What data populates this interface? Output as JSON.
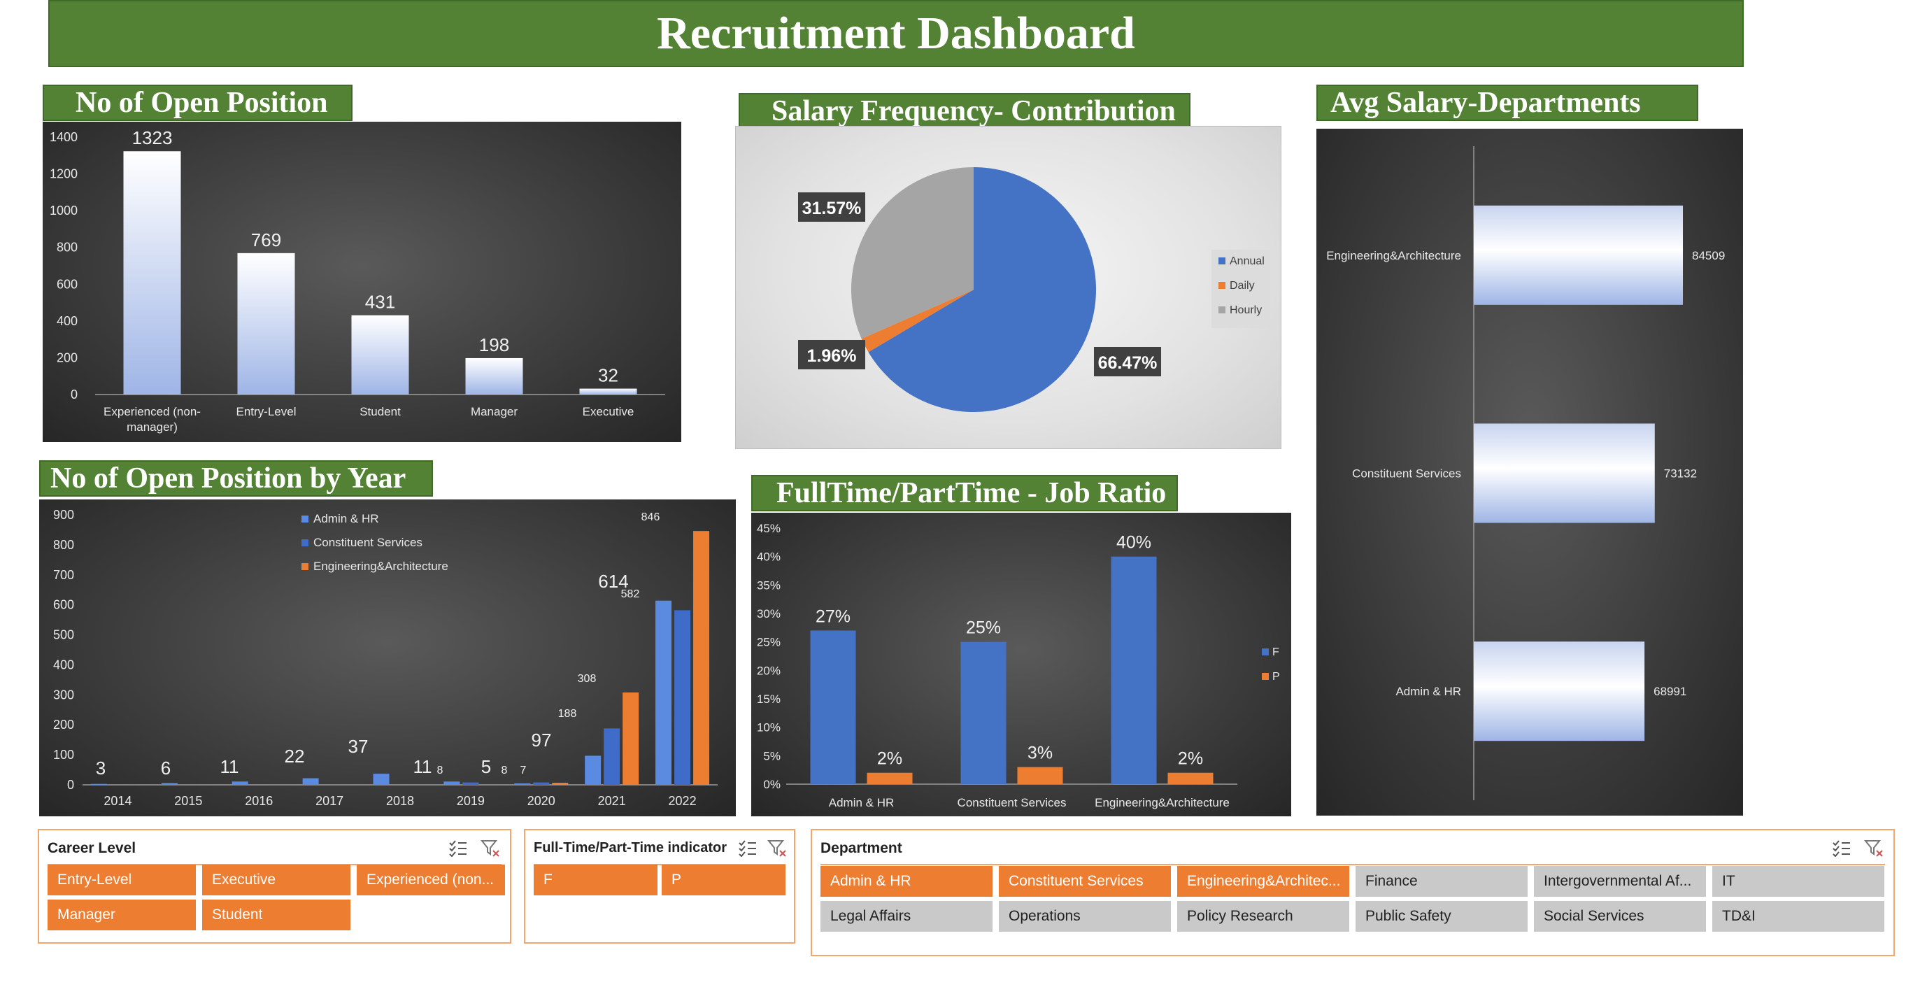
{
  "dashboard": {
    "title": "Recruitment Dashboard"
  },
  "sections": {
    "open_position": "No of Open Position",
    "salary_freq": "Salary Frequency- Contribution",
    "avg_salary": "Avg Salary-Departments",
    "by_year": "No of Open Position by Year",
    "job_ratio": "FullTime/PartTime - Job Ratio"
  },
  "colors": {
    "green": "#548235",
    "blue": "#4472c4",
    "orange": "#ed7d31",
    "gray": "#a5a5a5"
  },
  "chart_data": [
    {
      "id": "open_position",
      "type": "bar",
      "categories": [
        "Experienced (non-manager)",
        "Entry-Level",
        "Student",
        "Manager",
        "Executive"
      ],
      "values": [
        1323,
        769,
        431,
        198,
        32
      ],
      "ylim": [
        0,
        1400
      ],
      "yticks": [
        0,
        200,
        400,
        600,
        800,
        1000,
        1200,
        1400
      ],
      "grid": false
    },
    {
      "id": "salary_freq",
      "type": "pie",
      "labels": [
        "Annual",
        "Daily",
        "Hourly"
      ],
      "values": [
        66.47,
        1.96,
        31.57
      ],
      "data_labels": [
        "66.47%",
        "1.96%",
        "31.57%"
      ],
      "legend": "right"
    },
    {
      "id": "avg_salary",
      "type": "bar",
      "orientation": "horizontal",
      "categories": [
        "Engineering&Architecture",
        "Constituent Services",
        "Admin & HR"
      ],
      "values": [
        84509,
        73132,
        68991
      ]
    },
    {
      "id": "by_year",
      "type": "bar",
      "categories": [
        "2014",
        "2015",
        "2016",
        "2017",
        "2018",
        "2019",
        "2020",
        "2021",
        "2022"
      ],
      "series": [
        {
          "name": "Admin & HR",
          "values": [
            3,
            6,
            11,
            22,
            37,
            11,
            5,
            97,
            614
          ]
        },
        {
          "name": "Constituent Services",
          "values": [
            0,
            0,
            0,
            0,
            0,
            8,
            8,
            188,
            582
          ]
        },
        {
          "name": "Engineering&Architecture",
          "values": [
            0,
            0,
            0,
            0,
            0,
            0,
            7,
            308,
            846
          ]
        }
      ],
      "ylim": [
        0,
        900
      ],
      "yticks": [
        0,
        100,
        200,
        300,
        400,
        500,
        600,
        700,
        800,
        900
      ],
      "legend": "top-left"
    },
    {
      "id": "job_ratio",
      "type": "bar",
      "categories": [
        "Admin & HR",
        "Constituent Services",
        "Engineering&Architecture"
      ],
      "series": [
        {
          "name": "F",
          "values": [
            27,
            25,
            40
          ]
        },
        {
          "name": "P",
          "values": [
            2,
            3,
            2
          ]
        }
      ],
      "ylim": [
        0,
        45
      ],
      "yticks": [
        "0%",
        "5%",
        "10%",
        "15%",
        "20%",
        "25%",
        "30%",
        "35%",
        "40%",
        "45%"
      ],
      "legend": "right"
    }
  ],
  "slicers": {
    "career": {
      "title": "Career Level",
      "items": [
        {
          "label": "Entry-Level",
          "selected": true
        },
        {
          "label": "Executive",
          "selected": true
        },
        {
          "label": "Experienced (non...",
          "selected": true
        },
        {
          "label": "Manager",
          "selected": true
        },
        {
          "label": "Student",
          "selected": true
        }
      ]
    },
    "ftpt": {
      "title": "Full-Time/Part-Time indicator",
      "items": [
        {
          "label": "F",
          "selected": true
        },
        {
          "label": "P",
          "selected": true
        }
      ]
    },
    "department": {
      "title": "Department",
      "items": [
        {
          "label": "Admin & HR",
          "selected": true
        },
        {
          "label": "Constituent Services",
          "selected": true
        },
        {
          "label": "Engineering&Architec...",
          "selected": true
        },
        {
          "label": "Finance",
          "selected": false
        },
        {
          "label": "Intergovernmental Af...",
          "selected": false
        },
        {
          "label": "IT",
          "selected": false
        },
        {
          "label": "Legal Affairs",
          "selected": false
        },
        {
          "label": "Operations",
          "selected": false
        },
        {
          "label": "Policy Research",
          "selected": false
        },
        {
          "label": "Public Safety",
          "selected": false
        },
        {
          "label": "Social Services",
          "selected": false
        },
        {
          "label": "TD&I",
          "selected": false
        }
      ]
    }
  },
  "icons": {
    "multiselect": "multi-select-icon",
    "clear_filter": "clear-filter-icon"
  }
}
